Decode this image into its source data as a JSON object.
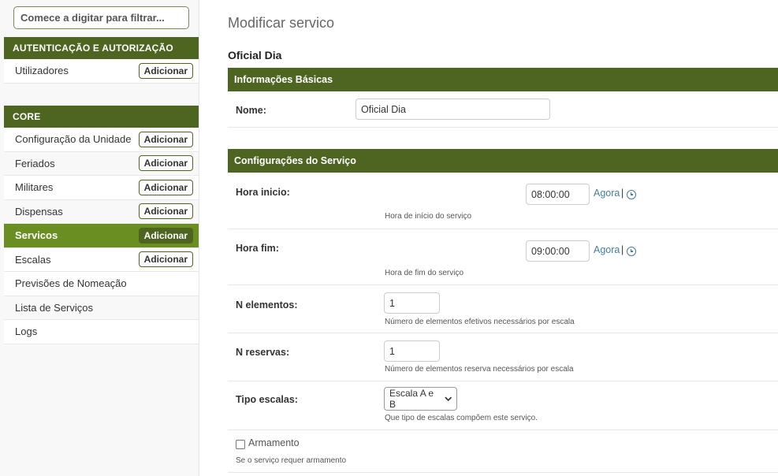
{
  "sidebar": {
    "filter_placeholder": "Comece a digitar para filtrar...",
    "modules": [
      {
        "title": "AUTENTICAÇÃO E AUTORIZAÇÃO",
        "items": [
          {
            "label": "Utilizadores",
            "add": "Adicionar"
          }
        ]
      },
      {
        "title": "CORE",
        "items": [
          {
            "label": "Configuração da Unidade",
            "add": "Adicionar"
          },
          {
            "label": "Feriados",
            "add": "Adicionar"
          },
          {
            "label": "Militares",
            "add": "Adicionar"
          },
          {
            "label": "Dispensas",
            "add": "Adicionar"
          },
          {
            "label": "Servicos",
            "add": "Adicionar",
            "active": true
          },
          {
            "label": "Escalas",
            "add": "Adicionar"
          },
          {
            "label": "Previsões de Nomeação"
          },
          {
            "label": "Lista de Serviços"
          },
          {
            "label": "Logs"
          }
        ]
      }
    ]
  },
  "main": {
    "title": "Modificar servico",
    "object_name": "Oficial Dia",
    "fieldsets": {
      "basic": {
        "title": "Informações Básicas",
        "nome_label": "Nome:",
        "nome_value": "Oficial Dia"
      },
      "config": {
        "title": "Configurações do Serviço",
        "hora_inicio_label": "Hora inicio:",
        "hora_inicio_value": "08:00:00",
        "hora_inicio_help": "Hora de início do serviço",
        "hora_fim_label": "Hora fim:",
        "hora_fim_value": "09:00:00",
        "hora_fim_help": "Hora de fim do serviço",
        "now_link": "Agora",
        "now_sep": "|",
        "n_elementos_label": "N elementos:",
        "n_elementos_value": "1",
        "n_elementos_help": "Número de elementos efetivos necessários por escala",
        "n_reservas_label": "N reservas:",
        "n_reservas_value": "1",
        "n_reservas_help": "Número de elementos reserva necessários por escala",
        "tipo_escalas_label": "Tipo escalas:",
        "tipo_escalas_value": "Escala A e B",
        "tipo_escalas_help": "Que tipo de escalas compõem este serviço.",
        "armamento_label": "Armamento",
        "armamento_checked": false,
        "armamento_help": "Se o serviço requer armamento"
      }
    }
  },
  "colors": {
    "header_green": "#4e6522",
    "active_green": "#6b8e23",
    "link_blue": "#447e9b"
  }
}
